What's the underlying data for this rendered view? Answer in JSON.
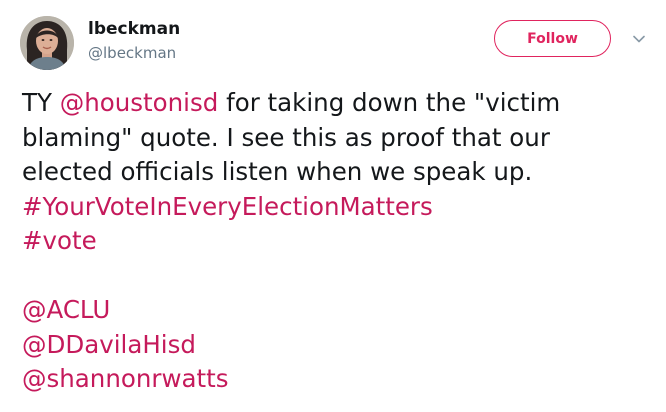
{
  "header": {
    "display_name": "lbeckman",
    "handle": "@lbeckman",
    "follow_label": "Follow"
  },
  "tweet": {
    "line1": {
      "prefix": "TY ",
      "mention": "@houstonisd",
      "suffix": " for taking down the \"victim"
    },
    "line2": "blaming\" quote. I see this as proof that our",
    "line3": "elected officials listen when we speak up.",
    "hashtags": [
      "#YourVoteInEveryElectionMatters",
      "#vote"
    ],
    "mentions": [
      "@ACLU",
      "@DDavilaHisd",
      "@shannonrwatts"
    ]
  },
  "colors": {
    "link": "#c51a5b",
    "follow_accent": "#e0245e",
    "handle_gray": "#657786",
    "text": "#14171a"
  },
  "icons": {
    "avatar": "user-avatar",
    "menu": "chevron-down-icon"
  }
}
